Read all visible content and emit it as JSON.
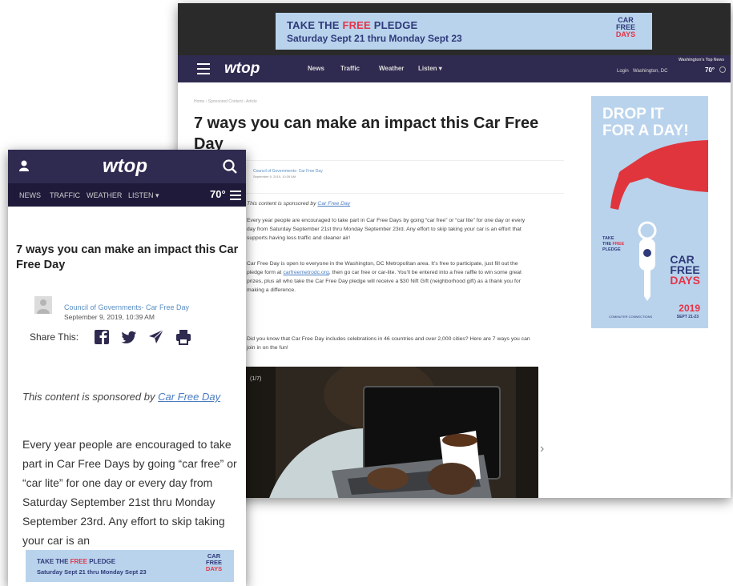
{
  "desktop": {
    "ad_banner": {
      "line1_pre": "TAKE THE ",
      "line1_free": "FREE",
      "line1_post": " PLEDGE",
      "line2": "Saturday Sept 21 thru Monday Sept 23",
      "logo_car": "CAR",
      "logo_free": "FREE",
      "logo_days": "DAYS"
    },
    "nav": {
      "logo": "wtop",
      "links": [
        "News",
        "Traffic",
        "Weather",
        "Listen ▾"
      ],
      "top_news": "Washington's Top News",
      "login": "Login",
      "location": "Washington, DC",
      "temperature": "70°"
    },
    "breadcrumb": "Home  ›  Sponsored Content  ›  Article",
    "title": "7 ways you can make an impact this Car Free Day",
    "author": "Council of Governments- Car Free Day",
    "date": "September 9, 2019, 10:39 AM",
    "sponsor_pre": "This content is sponsored by ",
    "sponsor_link": "Car Free Day",
    "paragraph1": "Every year people are encouraged to take part in Car Free Days by going “car free” or “car lite” for one day or every day from Saturday September 21st thru Monday September 23rd. Any effort to skip taking your car is an effort that supports having less traffic and cleaner air!",
    "paragraph2_pre": "Car Free Day is open to everyone in the Washington, DC Metropolitan area. It’s free to participate, just fill out the pledge form at ",
    "paragraph2_link": "carfreemetrodc.org",
    "paragraph2_post": ", then go car free or car-lite. You’ll be entered into a free raffle to win some great prizes, plus all who take the Car Free Day pledge will receive a $30 Nift Gift (neighborhood gift) as a thank you for making a difference.",
    "paragraph3": "Did you know that Car Free Day includes celebrations in 46 countries and over 2,000 cities? Here are 7 ways you can join in on the fun!",
    "slideshow_counter": "(1/7)",
    "side_ad": {
      "headline": "DROP IT FOR A DAY!",
      "take_line1": "TAKE",
      "take_line2_pre": "THE ",
      "take_line2_free": "FREE",
      "take_line3": "PLEDGE",
      "brand_car": "CAR",
      "brand_free": "FREE",
      "brand_days": "DAYS",
      "year": "2019",
      "dates": "SEPT 21-23",
      "sponsor": "COMMUTER CONNECTIONS"
    }
  },
  "mobile": {
    "logo": "wtop",
    "nav_links": [
      "NEWS",
      "TRAFFIC",
      "WEATHER",
      "LISTEN ▾"
    ],
    "temperature": "70°",
    "title": "7 ways you can make an impact this Car Free Day",
    "author": "Council of Governments- Car Free Day",
    "date": "September 9, 2019, 10:39 AM",
    "share_label": "Share This:",
    "sponsor_pre": "This content is sponsored by ",
    "sponsor_link": "Car Free Day",
    "body": "Every year people are encouraged to take part in Car Free Days by going “car free” or “car lite” for one day or every day from Saturday September 21st thru Monday September 23rd. Any effort to skip taking your car is an",
    "ad_banner": {
      "line1_pre": "TAKE THE ",
      "line1_free": "FREE",
      "line1_post": " PLEDGE",
      "line2": "Saturday Sept 21 thru Monday Sept 23",
      "logo_car": "CAR",
      "logo_free": "FREE",
      "logo_days": "DAYS"
    }
  },
  "colors": {
    "nav_purple": "#2f2a4f",
    "ad_blue": "#b9d3ec",
    "brand_red": "#e53347",
    "link_blue": "#4a7cc3"
  }
}
